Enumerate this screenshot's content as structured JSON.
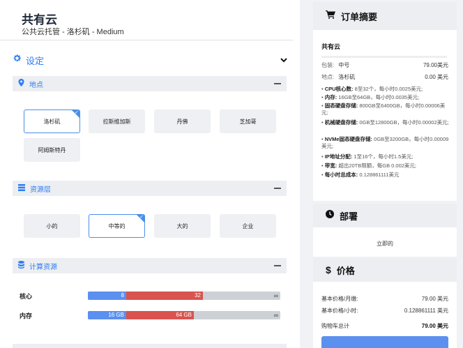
{
  "header": {
    "title": "共有云",
    "subtitle": "公共云托管 - 洛杉矶 - Medium"
  },
  "settings": {
    "title": "设定"
  },
  "location": {
    "title": "地点",
    "options": [
      "洛杉矶",
      "拉斯维加斯",
      "丹佛",
      "芝加哥",
      "阿姆斯特丹"
    ],
    "selected": "洛杉矶"
  },
  "tier": {
    "title": "资源层",
    "options": [
      "小的",
      "中等的",
      "大的",
      "企业"
    ],
    "selected": "中等的"
  },
  "compute": {
    "title": "计算资源",
    "core": {
      "label": "核心",
      "min": "8",
      "max": "32",
      "inf": "∞",
      "min_frac": 0.2,
      "max_frac": 0.6
    },
    "memory": {
      "label": "内存",
      "min": "16 GB",
      "max": "64 GB",
      "inf": "∞",
      "min_frac": 0.2,
      "max_frac": 0.55
    }
  },
  "summary": {
    "title": "订单摘要",
    "product": "共有云",
    "package_label": "包装:",
    "package_value": "中号",
    "package_price": "79.00美元",
    "location_label": "地点:",
    "location_value": "洛杉矶",
    "location_price": "0.00 美元",
    "specs": [
      {
        "bold": "CPU核心数:",
        "text": "8至32个，每小时0.0025美元;"
      },
      {
        "bold": "内存:",
        "text": "16GB至64GB，每小时0.0035美元;"
      },
      {
        "bold": "固态硬盘存储:",
        "text": "800GB至6400GB，每小时0.00006美元;"
      },
      {
        "bold": "机械硬盘存储:",
        "text": "0GB至12800GB，每小时0.00002美元;"
      },
      {
        "bold": "NVMe固态硬盘存储:",
        "text": "0GB至3200GB，每小时0.00009美元;"
      },
      {
        "bold": "IP地址分配:",
        "text": "1至16个，每小时1.5美元;"
      },
      {
        "bold": "带宽:",
        "text": "超出20TB限额，每GB 0.002美元;"
      },
      {
        "bold": "每小时总成本:",
        "text": "0.128861111美元"
      }
    ]
  },
  "deploy": {
    "title": "部署",
    "value": "立即的"
  },
  "price": {
    "title": "价格",
    "monthly_label": "基本价格/月缴:",
    "monthly_value": "79.00 美元",
    "hourly_label": "基本价格/小时:",
    "hourly_value": "0.128861111 美元",
    "total_label": "购物车总计",
    "total_value": "79.00 美元"
  },
  "colors": {
    "accent": "#2d7cf6",
    "bar_min": "#5b90ef",
    "bar_max": "#d9534f",
    "bar_rest": "#cdd1d6"
  }
}
